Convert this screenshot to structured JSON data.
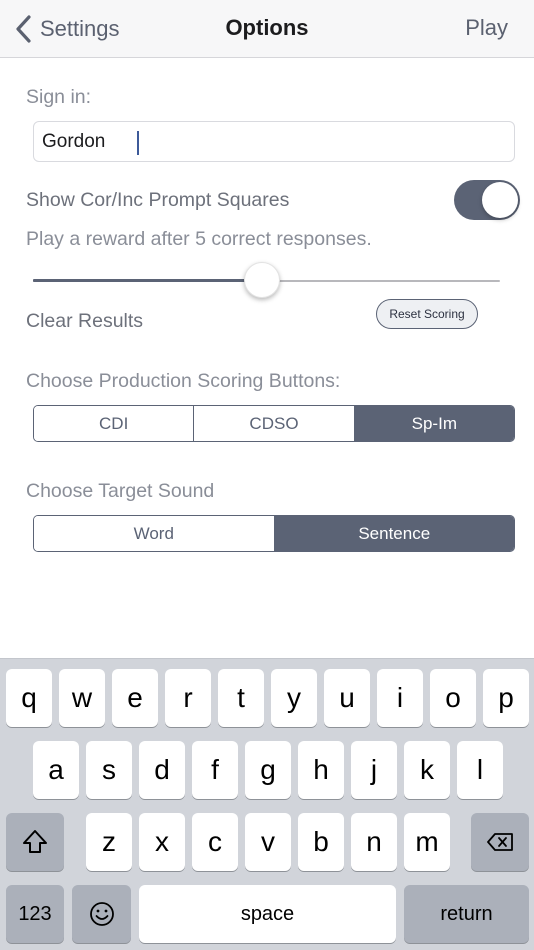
{
  "navbar": {
    "back_label": "Settings",
    "title": "Options",
    "action_label": "Play"
  },
  "sign_in": {
    "label": "Sign in:",
    "value": "Gordon"
  },
  "prompt_squares": {
    "label": "Show Cor/Inc Prompt Squares",
    "enabled": true
  },
  "reward": {
    "label": "Play a reward after 5 correct responses.",
    "slider_fraction": 0.49
  },
  "clear_results": {
    "label": "Clear Results",
    "button_label": "Reset Scoring"
  },
  "production_scoring": {
    "label": "Choose Production Scoring Buttons:",
    "options": [
      "CDI",
      "CDSO",
      "Sp-Im"
    ],
    "selected": "Sp-Im"
  },
  "target_sound": {
    "label": "Choose Target Sound",
    "options": [
      "Word",
      "Sentence"
    ],
    "selected": "Sentence"
  },
  "keyboard": {
    "row1": [
      "q",
      "w",
      "e",
      "r",
      "t",
      "y",
      "u",
      "i",
      "o",
      "p"
    ],
    "row2": [
      "a",
      "s",
      "d",
      "f",
      "g",
      "h",
      "j",
      "k",
      "l"
    ],
    "row3": [
      "z",
      "x",
      "c",
      "v",
      "b",
      "n",
      "m"
    ],
    "numbers_label": "123",
    "space_label": "space",
    "return_label": "return"
  },
  "colors": {
    "accent": "#5b6375",
    "label_text": "#8a8e98",
    "keyboard_bg": "#d1d4da"
  }
}
